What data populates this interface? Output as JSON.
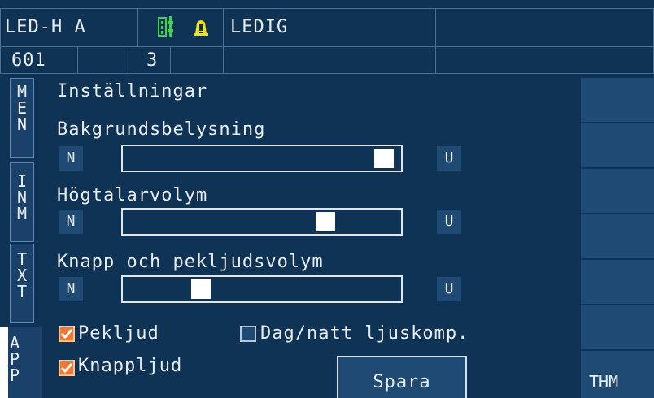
{
  "header": {
    "device_name": "LED-H A",
    "status_text": "LEDIG",
    "number": "601",
    "channel": "3",
    "icons": [
      "signal-icon",
      "warning-bell-icon"
    ]
  },
  "side_tabs": [
    {
      "letters": [
        "M",
        "E",
        "N"
      ]
    },
    {
      "letters": [
        "I",
        "N",
        "M"
      ]
    },
    {
      "letters": [
        "T",
        "X",
        "T"
      ]
    },
    {
      "letters": [
        "A",
        "P",
        "P"
      ]
    }
  ],
  "settings": {
    "title": "Inställningar",
    "sliders": [
      {
        "label": "Bakgrundsbelysning",
        "min_label": "N",
        "max_label": "U",
        "level": 0.98
      },
      {
        "label": "Högtalarvolym",
        "min_label": "N",
        "max_label": "U",
        "level": 0.75
      },
      {
        "label": "Knapp och pekljudsvolym",
        "min_label": "N",
        "max_label": "U",
        "level": 0.26
      }
    ],
    "checkboxes": [
      {
        "label": "Pekljud",
        "checked": true
      },
      {
        "label": "Dag/natt ljuskomp.",
        "checked": false
      },
      {
        "label": "Knappljud",
        "checked": true
      }
    ],
    "save_label": "Spara"
  },
  "right_panel": {
    "bottom_label": "THM"
  },
  "colors": {
    "background": "#0f3355",
    "button": "#1f4a74",
    "checkbox_on": "#f07830",
    "signal_green": "#3cd64a",
    "warning_yellow": "#f2e21a"
  }
}
